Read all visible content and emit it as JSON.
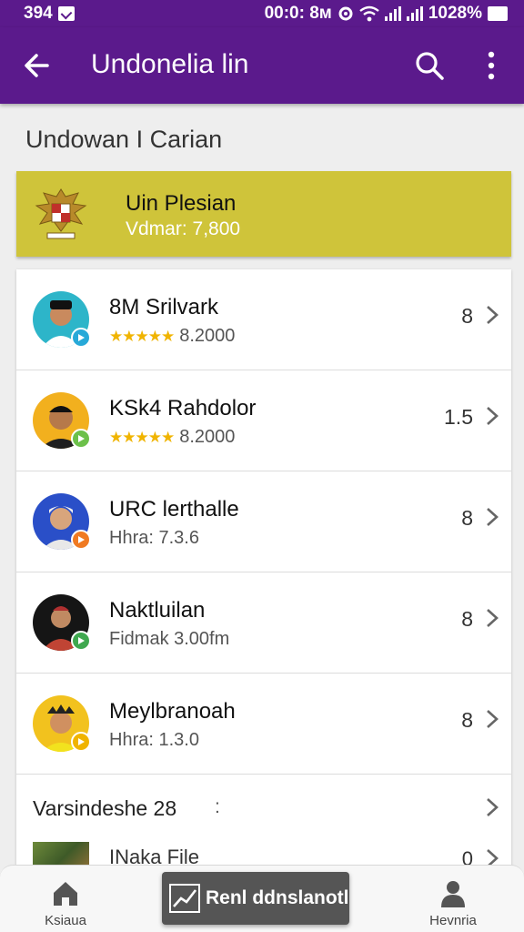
{
  "status_bar": {
    "time_left": "394",
    "time_center": "00:0: 8м",
    "battery_text": "1028%"
  },
  "app_bar": {
    "title": "Undonelia lin"
  },
  "section_title": "Undowan I Carian",
  "highlight": {
    "title": "Uin Plesian",
    "subtitle": "Vdmar: 7,800"
  },
  "rows": [
    {
      "name": "8M Srilvark",
      "stars": "★★★★★",
      "sub": "8.2000",
      "count": "8",
      "avatar_color": "#2db5c9",
      "badge_color": "#27a9d8"
    },
    {
      "name": "KSk4 Rahdolor",
      "stars": "★★★★★",
      "sub": "8.2000",
      "count": "1.5",
      "avatar_color": "#f2b01e",
      "badge_color": "#6cc04a"
    },
    {
      "name": "URC lerthalle",
      "stars": "",
      "sub": "Hhra: 7.3.6",
      "count": "8",
      "avatar_color": "#2a4fc8",
      "badge_color": "#f07a22"
    },
    {
      "name": "Naktluilan",
      "stars": "",
      "sub": "Fidmak 3.00fm",
      "count": "8",
      "avatar_color": "#151515",
      "badge_color": "#3fa84f"
    },
    {
      "name": "Meylbranoah",
      "stars": "",
      "sub": "Hhra: 1.3.0",
      "count": "8",
      "avatar_color": "#f2c21e",
      "badge_color": "#f0b400"
    }
  ],
  "version_row": {
    "label": "Varsindeshe 28",
    "suffix": ":"
  },
  "partial_row": {
    "name": "INaka File",
    "count": "0"
  },
  "bottom_nav": {
    "home_label": "Ksiaua",
    "profile_label": "Hevnria",
    "fab_label": "Renl ddnslanotl"
  },
  "colors": {
    "primary": "#5b1a8c",
    "highlight": "#cfc43a",
    "star": "#f0b400"
  }
}
